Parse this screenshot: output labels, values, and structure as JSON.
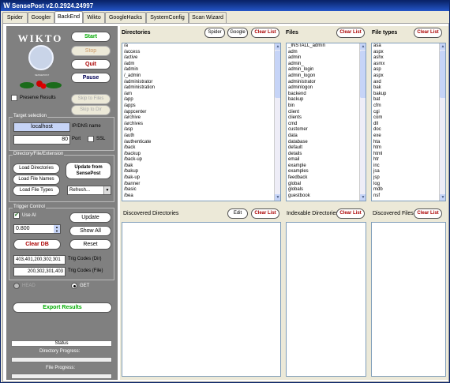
{
  "window": {
    "title": "SensePost  v2.0.2924.24997",
    "logo": "W"
  },
  "tabs": [
    "Spider",
    "Googler",
    "BackEnd",
    "Wikto",
    "GoogleHacks",
    "SystemConfig",
    "Scan Wizard"
  ],
  "active_tab": "BackEnd",
  "brand": {
    "name": "WIKTO",
    "sub": "SENSEPOST"
  },
  "controls": {
    "start": "Start",
    "stop": "Stop",
    "quit": "Quit",
    "pause": "Pause",
    "preserve_results": "Preserve Results",
    "skip_to_files": "Skip to Files",
    "skip_to_dir": "Skip to Dir"
  },
  "target": {
    "section": "Target selection",
    "host": "localhost",
    "host_label": "IP/DNS name",
    "port": "80",
    "port_label": "Port",
    "ssl_label": "SSL"
  },
  "dirfile": {
    "section": "Directory/File/Extension",
    "load_dirs": "Load Directories",
    "load_files": "Load File Names",
    "load_types": "Load File Types",
    "update": "Update from SensePost",
    "refresh": "Refresh..."
  },
  "trigger": {
    "section": "Trigger Control",
    "use_ai": "Use AI",
    "update": "Update",
    "value": "0.800",
    "show_all": "Show All",
    "clear_db": "Clear DB",
    "reset": "Reset",
    "codes_dir": "403,401,200,302,301",
    "codes_dir_label": "Trig Codes (Dir)",
    "codes_file": "200,302,301,403",
    "codes_file_label": "Trig Codes (File)",
    "head": "HEAD",
    "get": "GET"
  },
  "export": "Export Results",
  "status": {
    "status_label": "Status",
    "dir_progress": "Directory Progress:",
    "file_progress": "File Progress:"
  },
  "directories": {
    "title": "Directories",
    "spider": "Spider",
    "google": "Google",
    "clear": "Clear List",
    "items": [
      "/a",
      "/access",
      "/active",
      "/adm",
      "/admin",
      "/_admin",
      "/administrator",
      "/administration",
      "/am",
      "/app",
      "/apps",
      "/appcenter",
      "/archive",
      "/archives",
      "/asp",
      "/auth",
      "/authenticate",
      "/back",
      "/backup",
      "/back-up",
      "/bak",
      "/bakup",
      "/bak-up",
      "/banner",
      "/basic",
      "/bea"
    ]
  },
  "files": {
    "title": "Files",
    "clear": "Clear List",
    "items": [
      "_INSTALL_admin",
      "adm",
      "admin",
      "admin_",
      "admin_login",
      "admin_logon",
      "administrator",
      "adminlogon",
      "backend",
      "backup",
      "bin",
      "client",
      "clients",
      "cmd",
      "customer",
      "data",
      "database",
      "default",
      "details",
      "email",
      "example",
      "examples",
      "feedback",
      "global",
      "globals",
      "guestbook"
    ]
  },
  "filetypes": {
    "title": "File types",
    "clear": "Clear List",
    "items": [
      "asa",
      "aspx",
      "ashx",
      "asmx",
      "asp",
      "aspx",
      "axd",
      "bak",
      "bakup",
      "bat",
      "cfm",
      "cgi",
      "com",
      "dll",
      "doc",
      "exe",
      "hta",
      "htm",
      "html",
      "htr",
      "inc",
      "jsa",
      "jsp",
      "log",
      "mdb",
      "nsf"
    ]
  },
  "discovered": {
    "dirs_title": "Discovered Directories",
    "edit": "Edit",
    "clear": "Clear List",
    "indexable_title": "Indexable Directories",
    "files_title": "Discovered Files"
  }
}
